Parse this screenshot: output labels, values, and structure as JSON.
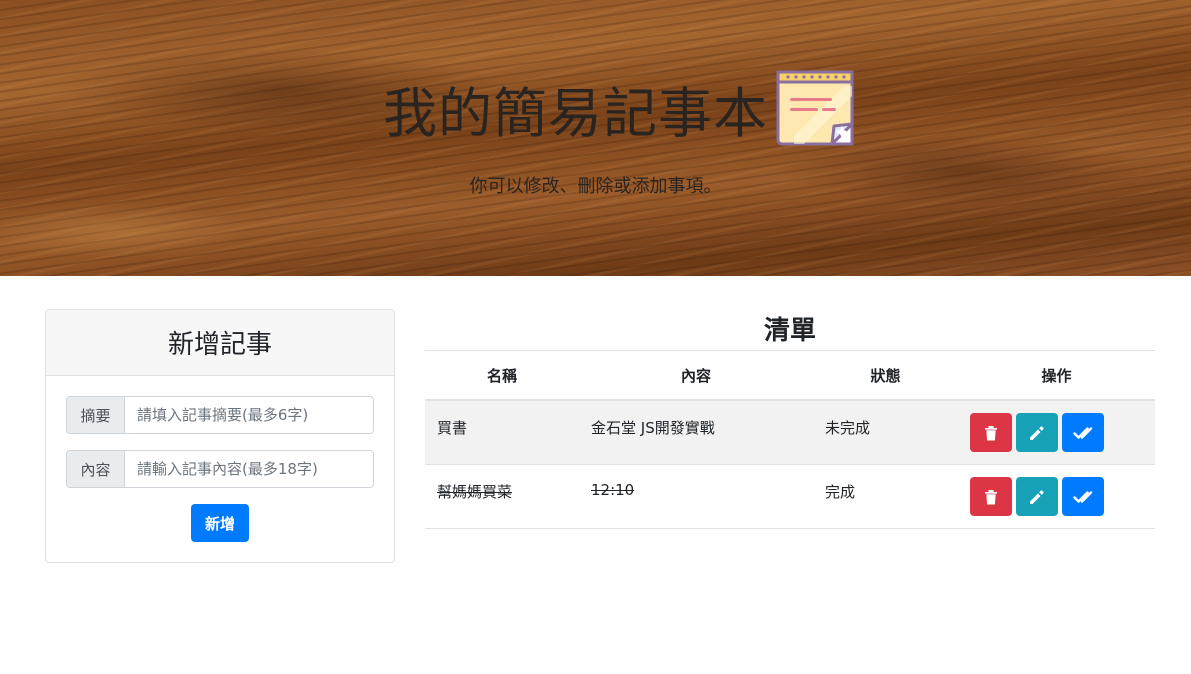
{
  "hero": {
    "title": "我的簡易記事本",
    "subtitle": "你可以修改、刪除或添加事項。",
    "icon": "notepad-icon"
  },
  "add_card": {
    "title": "新增記事",
    "summary_label": "摘要",
    "summary_placeholder": "請填入記事摘要(最多6字)",
    "summary_value": "",
    "content_label": "內容",
    "content_placeholder": "請輸入記事內容(最多18字)",
    "content_value": "",
    "add_button": "新增"
  },
  "list": {
    "title": "清單",
    "headers": {
      "name": "名稱",
      "content": "內容",
      "status": "狀態",
      "ops": "操作"
    },
    "rows": [
      {
        "name": "買書",
        "content": "金石堂 JS開發實戰",
        "status": "未完成",
        "done": false
      },
      {
        "name": "幫媽媽買菜",
        "content": "12:10",
        "status": "完成",
        "done": true
      }
    ],
    "op_icons": [
      "trash-icon",
      "pencil-icon",
      "check-double-icon"
    ]
  },
  "colors": {
    "primary": "#007bff",
    "danger": "#dc3545",
    "info": "#17a2b8"
  }
}
